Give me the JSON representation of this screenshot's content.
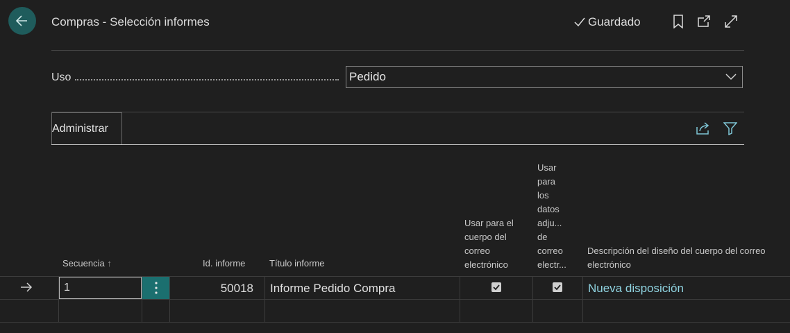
{
  "header": {
    "title": "Compras - Selección informes",
    "saved_label": "Guardado"
  },
  "filter": {
    "label": "Uso",
    "value": "Pedido"
  },
  "actions": {
    "tab_label": "Administrar"
  },
  "table": {
    "columns": {
      "sequence": "Secuencia",
      "report_id": "Id. informe",
      "report_title": "Título informe",
      "email_body_lines": [
        "Usar para el",
        "cuerpo del",
        "correo",
        "electrónico"
      ],
      "attachment_lines": [
        "Usar",
        "para",
        "los",
        "datos",
        "adju...",
        "de",
        "correo",
        "electr..."
      ],
      "layout_desc_lines": [
        "Descripción del diseño del cuerpo del correo",
        "electrónico"
      ]
    },
    "rows": [
      {
        "sequence": "1",
        "report_id": "50018",
        "report_title": "Informe Pedido Compra",
        "use_email_body": true,
        "use_email_attachment": true,
        "layout_description": "Nueva disposición"
      }
    ]
  },
  "colors": {
    "accent": "#1f5c5c",
    "link": "#8fd3e0",
    "teal_button": "#1b6f6f"
  },
  "icons": [
    "back-arrow-icon",
    "checkmark-icon",
    "bookmark-icon",
    "open-new-window-icon",
    "expand-icon",
    "chevron-down-icon",
    "share-icon",
    "filter-icon",
    "sort-ascending-icon",
    "row-arrow-icon",
    "more-options-icon",
    "checkbox-checked-icon"
  ]
}
